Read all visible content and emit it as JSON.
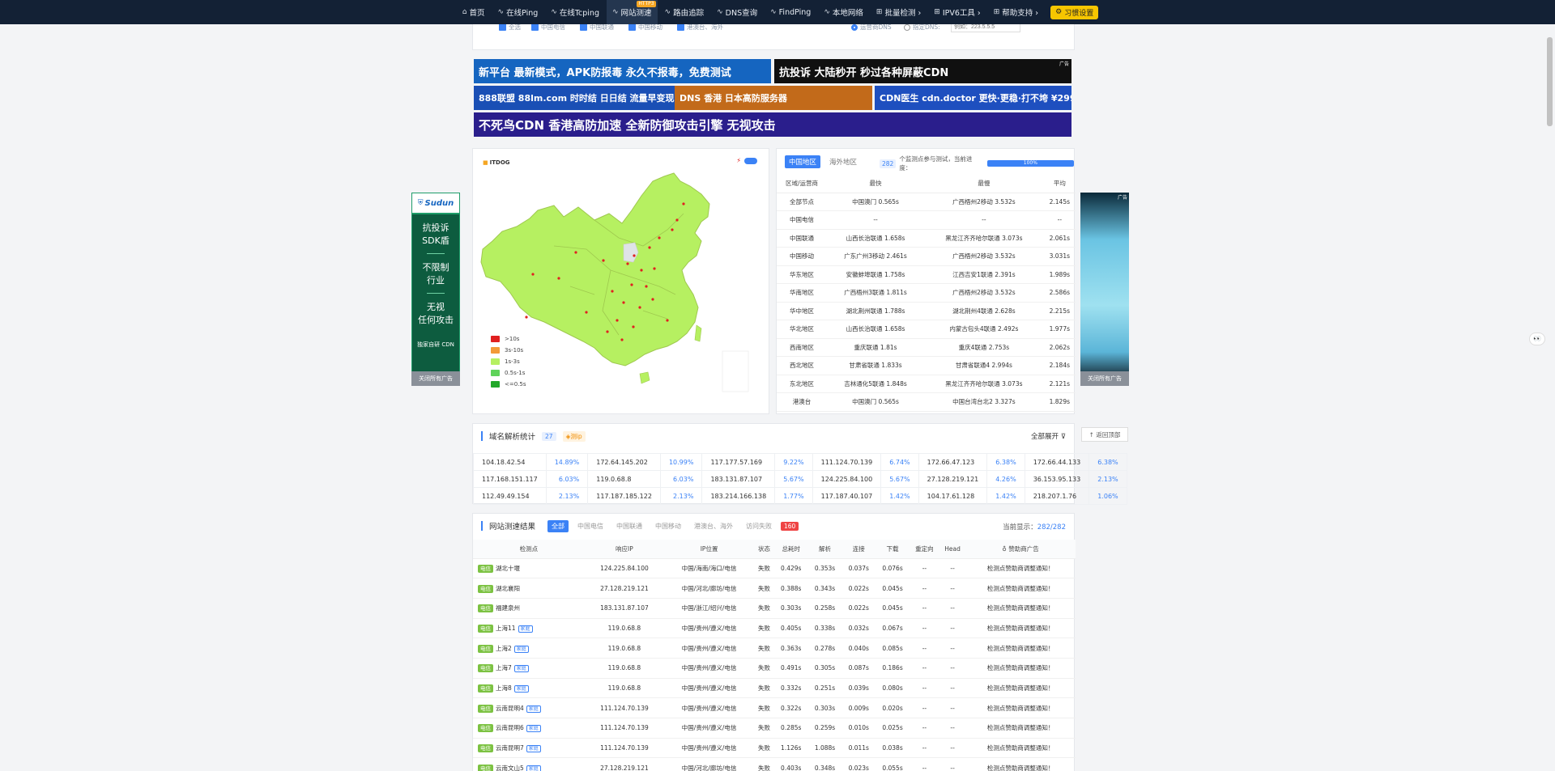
{
  "nav": {
    "items": [
      {
        "icon": "home-icon",
        "glyph": "⌂",
        "label": "首页"
      },
      {
        "icon": "pulse-icon",
        "glyph": "∿",
        "label": "在线Ping"
      },
      {
        "icon": "pulse-icon",
        "glyph": "∿",
        "label": "在线Tcping"
      },
      {
        "icon": "pulse-icon",
        "glyph": "∿",
        "label": "网站测速",
        "hot": "HTTP3",
        "active": true
      },
      {
        "icon": "pulse-icon",
        "glyph": "∿",
        "label": "路由追踪"
      },
      {
        "icon": "pulse-icon",
        "glyph": "∿",
        "label": "DNS查询"
      },
      {
        "icon": "pulse-icon",
        "glyph": "∿",
        "label": "FindPing"
      },
      {
        "icon": "pulse-icon",
        "glyph": "∿",
        "label": "本地网络"
      },
      {
        "icon": "grid-icon",
        "glyph": "⊞",
        "label": "批量检测 ›"
      },
      {
        "icon": "grid-icon",
        "glyph": "⊞",
        "label": "IPV6工具 ›"
      },
      {
        "icon": "grid-icon",
        "glyph": "⊞",
        "label": "帮助支持 ›"
      }
    ],
    "habit_label": "习惯设置"
  },
  "options": {
    "checks": [
      "全选",
      "中国电信",
      "中国联通",
      "中国移动",
      "港澳台、海外"
    ],
    "radio_on": "运营商DNS",
    "radio_off": "指定DNS:",
    "dns_placeholder": "例如：223.5.5.5"
  },
  "banners": [
    {
      "text": "新平台 最新模式，APK防报毒 永久不报毒，免费测试",
      "bg": "#1565c0",
      "fg": "#ffffff"
    },
    {
      "text": "抗投诉 大陆秒开 秒过各种屏蔽CDN",
      "bg": "#101010",
      "fg": "#ffffff",
      "tag": "广告"
    },
    {
      "text": "888联盟 88lm.com 时时结 日日结 流量早变现",
      "bg": "#1a4fb5",
      "fg": "#ffffff"
    },
    {
      "text": "DNS 香港 日本高防服务器",
      "bg": "#c26a1a",
      "fg": "#ffffff"
    },
    {
      "text": "CDN医生 cdn.doctor 更快·更稳·打不垮 ¥299起",
      "bg": "#1e4fbf",
      "fg": "#ffffff"
    },
    {
      "text": "不死鸟CDN 香港高防加速 全新防御攻击引擎 无视攻击",
      "bg": "#2a1e8c",
      "fg": "#ffffff"
    }
  ],
  "map": {
    "logo": "ITDOG",
    "legend": [
      {
        "label": ">10s",
        "color": "#e02020"
      },
      {
        "label": "3s-10s",
        "color": "#f29a38"
      },
      {
        "label": "1s-3s",
        "color": "#b6f061"
      },
      {
        "label": "0.5s-1s",
        "color": "#5fd35a"
      },
      {
        "label": "<=0.5s",
        "color": "#22a82a"
      }
    ]
  },
  "stats": {
    "tabs": [
      "中国地区",
      "海外地区"
    ],
    "count": "282",
    "count_text": "个监测点参与测试，当前进度：",
    "progress_pct": 100,
    "progress_label": "100%",
    "headers": [
      "区域/运营商",
      "最快",
      "最慢",
      "平均"
    ],
    "rows": [
      [
        "全部节点",
        "中国澳门 0.565s",
        "广西梧州2移动 3.532s",
        "2.145s"
      ],
      [
        "中国电信",
        "--",
        "--",
        "--"
      ],
      [
        "中国联通",
        "山西长治联通 1.658s",
        "黑龙江齐齐哈尔联通 3.073s",
        "2.061s"
      ],
      [
        "中国移动",
        "广东广州3移动 2.461s",
        "广西梧州2移动 3.532s",
        "3.031s"
      ],
      [
        "华东地区",
        "安徽蚌埠联通 1.758s",
        "江西吉安1联通 2.391s",
        "1.989s"
      ],
      [
        "华南地区",
        "广西梧州3联通 1.811s",
        "广西梧州2移动 3.532s",
        "2.586s"
      ],
      [
        "华中地区",
        "湖北荆州联通 1.788s",
        "湖北荆州4联通 2.628s",
        "2.215s"
      ],
      [
        "华北地区",
        "山西长治联通 1.658s",
        "内蒙古包头4联通 2.492s",
        "1.977s"
      ],
      [
        "西南地区",
        "重庆联通 1.81s",
        "重庆4联通 2.753s",
        "2.062s"
      ],
      [
        "西北地区",
        "甘肃省联通 1.833s",
        "甘肃省联通4 2.994s",
        "2.184s"
      ],
      [
        "东北地区",
        "吉林通化5联通 1.848s",
        "黑龙江齐齐哈尔联通 3.073s",
        "2.121s"
      ],
      [
        "港澳台",
        "中国澳门 0.565s",
        "中国台湾台北2 3.327s",
        "1.829s"
      ]
    ]
  },
  "left_ad": {
    "brand": "Sudun",
    "l1": "抗投诉",
    "l2": "SDK盾",
    "l3": "不限制",
    "l4": "行业",
    "l5": "无视",
    "l6": "任何攻击",
    "l7": "独家自研 CDN",
    "close": "关闭所有广告"
  },
  "right_ad": {
    "tag": "广告",
    "close": "关闭所有广告"
  },
  "dns": {
    "title": "域名解析统计",
    "count": "27",
    "badge": "测ip",
    "expand": "全部展开",
    "rows": [
      [
        [
          "104.18.42.54",
          "14.89%"
        ],
        [
          "172.64.145.202",
          "10.99%"
        ],
        [
          "117.177.57.169",
          "9.22%"
        ],
        [
          "111.124.70.139",
          "6.74%"
        ],
        [
          "172.66.47.123",
          "6.38%"
        ],
        [
          "172.66.44.133",
          "6.38%"
        ]
      ],
      [
        [
          "117.168.151.117",
          "6.03%"
        ],
        [
          "119.0.68.8",
          "6.03%"
        ],
        [
          "183.131.87.107",
          "5.67%"
        ],
        [
          "124.225.84.100",
          "5.67%"
        ],
        [
          "27.128.219.121",
          "4.26%"
        ],
        [
          "36.153.95.133",
          "2.13%"
        ]
      ],
      [
        [
          "112.49.49.154",
          "2.13%"
        ],
        [
          "117.187.185.122",
          "2.13%"
        ],
        [
          "183.214.166.138",
          "1.77%"
        ],
        [
          "117.187.40.107",
          "1.42%"
        ],
        [
          "104.17.61.128",
          "1.42%"
        ],
        [
          "218.207.1.76",
          "1.06%"
        ]
      ]
    ]
  },
  "backtop": "返回顶部",
  "results": {
    "title": "网站测速结果",
    "tabs": [
      "全部",
      "中国电信",
      "中国联通",
      "中国移动",
      "港澳台、海外",
      "访问失败"
    ],
    "fail_count": "160",
    "showing_label": "当前显示：",
    "showing_value": "282/282",
    "headers": [
      "检测点",
      "响应IP",
      "IP位置",
      "状态",
      "总耗时",
      "解析",
      "连接",
      "下载",
      "重定向",
      "Head",
      "赞助商广告"
    ],
    "rows": [
      {
        "isp": "电信",
        "name": "湖北十堰",
        "home": "",
        "ip": "124.225.84.100",
        "loc": "中国/海南/海口/电信",
        "status": "失败",
        "total": "0.429s",
        "tc": "green",
        "dns": "0.353s",
        "conn": "0.037s",
        "dl": "0.076s",
        "redir": "--",
        "head": "--",
        "ad": "检测点赞助商调整通知！"
      },
      {
        "isp": "电信",
        "name": "湖北襄阳",
        "home": "",
        "ip": "27.128.219.121",
        "loc": "中国/河北/廊坊/电信",
        "status": "失败",
        "total": "0.388s",
        "tc": "green",
        "dns": "0.343s",
        "conn": "0.022s",
        "dl": "0.045s",
        "redir": "--",
        "head": "--",
        "ad": "检测点赞助商调整通知！"
      },
      {
        "isp": "电信",
        "name": "福建泉州",
        "home": "",
        "ip": "183.131.87.107",
        "loc": "中国/浙江/绍兴/电信",
        "status": "失败",
        "total": "0.303s",
        "tc": "green",
        "dns": "0.258s",
        "conn": "0.022s",
        "dl": "0.045s",
        "redir": "--",
        "head": "--",
        "ad": "检测点赞助商调整通知！"
      },
      {
        "isp": "电信",
        "name": "上海11",
        "home": "家庭",
        "ip": "119.0.68.8",
        "loc": "中国/贵州/遵义/电信",
        "status": "失败",
        "total": "0.405s",
        "tc": "green",
        "dns": "0.338s",
        "conn": "0.032s",
        "dl": "0.067s",
        "redir": "--",
        "head": "--",
        "ad": "检测点赞助商调整通知！"
      },
      {
        "isp": "电信",
        "name": "上海2",
        "home": "家庭",
        "ip": "119.0.68.8",
        "loc": "中国/贵州/遵义/电信",
        "status": "失败",
        "total": "0.363s",
        "tc": "green",
        "dns": "0.278s",
        "conn": "0.040s",
        "dl": "0.085s",
        "redir": "--",
        "head": "--",
        "ad": "检测点赞助商调整通知！"
      },
      {
        "isp": "电信",
        "name": "上海7",
        "home": "家庭",
        "ip": "119.0.68.8",
        "loc": "中国/贵州/遵义/电信",
        "status": "失败",
        "total": "0.491s",
        "tc": "green",
        "dns": "0.305s",
        "conn": "0.087s",
        "dl": "0.186s",
        "redir": "--",
        "head": "--",
        "ad": "检测点赞助商调整通知！"
      },
      {
        "isp": "电信",
        "name": "上海8",
        "home": "家庭",
        "ip": "119.0.68.8",
        "loc": "中国/贵州/遵义/电信",
        "status": "失败",
        "total": "0.332s",
        "tc": "green",
        "dns": "0.251s",
        "conn": "0.039s",
        "dl": "0.080s",
        "redir": "--",
        "head": "--",
        "ad": "检测点赞助商调整通知！"
      },
      {
        "isp": "电信",
        "name": "云南昆明4",
        "home": "家庭",
        "ip": "111.124.70.139",
        "loc": "中国/贵州/遵义/电信",
        "status": "失败",
        "total": "0.322s",
        "tc": "green",
        "dns": "0.303s",
        "conn": "0.009s",
        "dl": "0.020s",
        "redir": "--",
        "head": "--",
        "ad": "检测点赞助商调整通知！"
      },
      {
        "isp": "电信",
        "name": "云南昆明6",
        "home": "家庭",
        "ip": "111.124.70.139",
        "loc": "中国/贵州/遵义/电信",
        "status": "失败",
        "total": "0.285s",
        "tc": "green",
        "dns": "0.259s",
        "conn": "0.010s",
        "dl": "0.025s",
        "redir": "--",
        "head": "--",
        "ad": "检测点赞助商调整通知！"
      },
      {
        "isp": "电信",
        "name": "云南昆明7",
        "home": "家庭",
        "ip": "111.124.70.139",
        "loc": "中国/贵州/遵义/电信",
        "status": "失败",
        "total": "1.126s",
        "tc": "yellow",
        "dns": "1.088s",
        "conn": "0.011s",
        "dl": "0.038s",
        "redir": "--",
        "head": "--",
        "ad": "检测点赞助商调整通知！"
      },
      {
        "isp": "电信",
        "name": "云南文山5",
        "home": "家庭",
        "ip": "27.128.219.121",
        "loc": "中国/河北/廊坊/电信",
        "status": "失败",
        "total": "0.403s",
        "tc": "green",
        "dns": "0.348s",
        "conn": "0.023s",
        "dl": "0.055s",
        "redir": "--",
        "head": "--",
        "ad": "检测点赞助商调整通知！"
      }
    ]
  },
  "floater": "👀"
}
